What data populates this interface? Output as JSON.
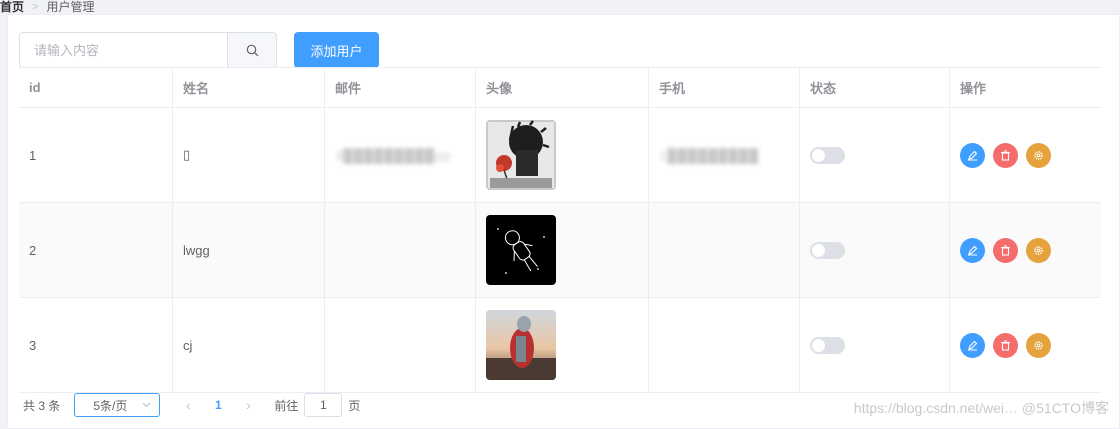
{
  "breadcrumb": {
    "home": "首页",
    "separator": ">",
    "current": "用户管理"
  },
  "search": {
    "placeholder": "请输入内容",
    "value": "",
    "icon": "search-icon"
  },
  "add_button": {
    "label": "添加用户"
  },
  "table": {
    "columns": [
      "id",
      "姓名",
      "邮件",
      "头像",
      "手机",
      "状态",
      "操作"
    ],
    "rows": [
      {
        "id": "1",
        "name": "▯",
        "email": "3█████████pp",
        "avatar": "avatar-boy-rose",
        "phone": "1█████████",
        "status_on": false
      },
      {
        "id": "2",
        "name": "lwgg",
        "email": "",
        "avatar": "avatar-astronaut-sketch",
        "phone": "",
        "status_on": false
      },
      {
        "id": "3",
        "name": "cj",
        "email": "",
        "avatar": "avatar-ultraman-sunset",
        "phone": "",
        "status_on": false
      }
    ],
    "row_actions": [
      "edit-icon",
      "delete-icon",
      "settings-icon"
    ]
  },
  "pagination": {
    "total": "共 3 条",
    "page_size": "5条/页",
    "current_page": "1",
    "goto_label": "前往",
    "goto_value": "1",
    "goto_suffix": "页"
  },
  "watermark": "https://blog.csdn.net/wei… @51CTO博客",
  "colors": {
    "primary": "#409eff",
    "danger": "#f56c6c",
    "warning": "#e6a23c"
  }
}
